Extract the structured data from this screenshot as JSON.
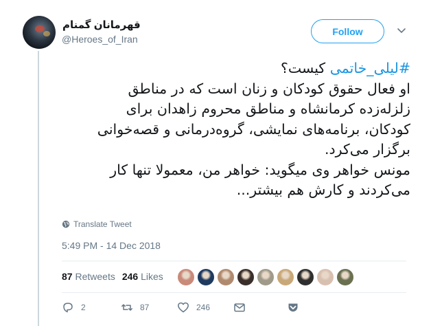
{
  "tweet": {
    "display_name": "قهرمانان گمنام",
    "handle": "@Heroes_of_Iran",
    "follow_label": "Follow",
    "hashtag": "#لیلی_خاتمی",
    "text_lines": [
      " کیست؟",
      "او فعال حقوق کودکان و زنان است که در مناطق",
      "زلزله‌زده کرمانشاه و مناطق محروم زاهدان برای",
      "کودکان، برنامه‌های نمایشی، گروه‌درمانی و قصه‌خوانی",
      "برگزار می‌کرد.",
      "مونس خواهر وی میگوید: خواهر من، معمولا تنها کار",
      "می‌کردند و کارش هم بیشتر..."
    ],
    "translate_label": "Translate Tweet",
    "timestamp": "5:49 PM - 14 Dec 2018",
    "retweets_count": "87",
    "retweets_label": "Retweets",
    "likes_count": "246",
    "likes_label": "Likes",
    "actions": {
      "reply_count": "2",
      "retweet_count": "87",
      "like_count": "246"
    },
    "liker_avatar_colors": [
      "#c98a7a",
      "#1e3a5f",
      "#b08a6e",
      "#3a2f2a",
      "#a09a8a",
      "#c8a878",
      "#2f2f2f",
      "#d8c0b0",
      "#6a7050"
    ],
    "colors": {
      "accent": "#1da1f2",
      "hashtag": "#1b95e0",
      "muted": "#657786"
    }
  }
}
